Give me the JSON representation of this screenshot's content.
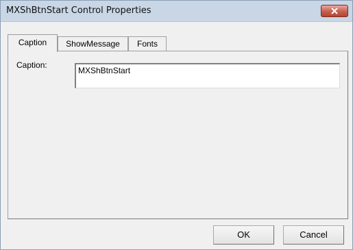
{
  "window": {
    "title": "MXShBtnStart Control Properties"
  },
  "tabs": [
    {
      "label": "Caption",
      "selected": true
    },
    {
      "label": "ShowMessage",
      "selected": false
    },
    {
      "label": "Fonts",
      "selected": false
    }
  ],
  "caption_tab": {
    "field_label": "Caption:",
    "field_value": "MXShBtnStart"
  },
  "buttons": {
    "ok_label": "OK",
    "cancel_label": "Cancel"
  },
  "colors": {
    "titlebar": "#c8d6e6",
    "dialog_bg": "#f0f0f0",
    "close_button": "#c75e4e"
  }
}
